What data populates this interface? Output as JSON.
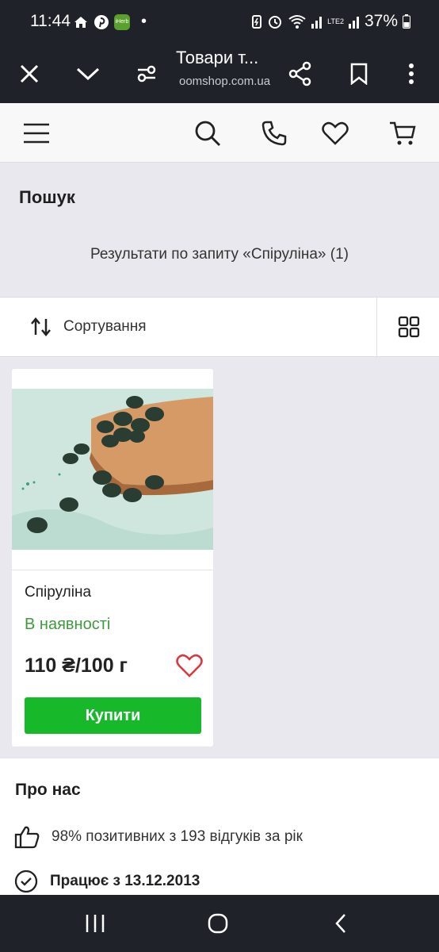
{
  "status_bar": {
    "time": "11:44",
    "iherb_label": "iHerb",
    "dot": "•",
    "battery": "37%",
    "volte_label": "LTE2"
  },
  "browser": {
    "title": "Товари т...",
    "url": "oomshop.com.ua"
  },
  "page": {
    "search_title": "Пошук",
    "results_text": "Результати по запиту «Спіруліна» (1)"
  },
  "sort": {
    "label": "Сортування"
  },
  "product": {
    "name": "Спіруліна",
    "stock": "В наявності",
    "price": "110 ₴/100 г",
    "buy_label": "Купити"
  },
  "about": {
    "title": "Про нас",
    "reviews": "98% позитивних з 193 відгуків за рік",
    "since": "Працює з 13.12.2013"
  },
  "colors": {
    "accent_green": "#17b92a",
    "stock_green": "#3e9a3c",
    "heart_red": "#d9363e",
    "bar_dark": "#1f2329"
  }
}
